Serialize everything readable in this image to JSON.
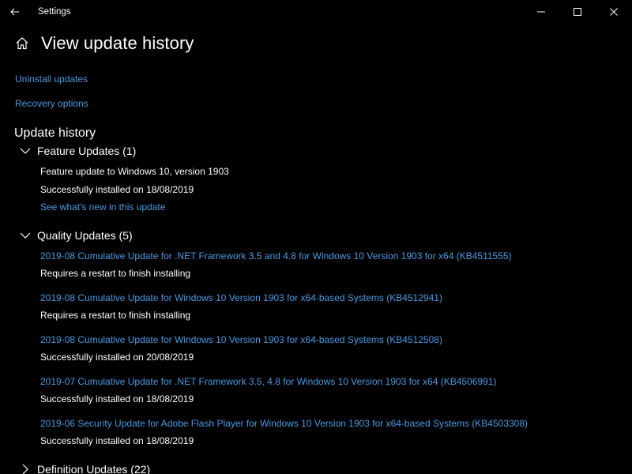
{
  "window": {
    "title": "Settings"
  },
  "header": {
    "page_title": "View update history"
  },
  "links": {
    "uninstall": "Uninstall updates",
    "recovery": "Recovery options"
  },
  "history": {
    "section_title": "Update history",
    "feature": {
      "label": "Feature Updates (1)",
      "items": [
        {
          "name": "Feature update to Windows 10, version 1903",
          "status": "Successfully installed on 18/08/2019",
          "link": "See what's new in this update"
        }
      ]
    },
    "quality": {
      "label": "Quality Updates (5)",
      "items": [
        {
          "name": "2019-08 Cumulative Update for .NET Framework 3.5 and 4.8 for Windows 10 Version 1903 for x64 (KB4511555)",
          "status": "Requires a restart to finish installing"
        },
        {
          "name": "2019-08 Cumulative Update for Windows 10 Version 1903 for x64-based Systems (KB4512941)",
          "status": "Requires a restart to finish installing"
        },
        {
          "name": "2019-08 Cumulative Update for Windows 10 Version 1903 for x64-based Systems (KB4512508)",
          "status": "Successfully installed on 20/08/2019"
        },
        {
          "name": "2019-07 Cumulative Update for .NET Framework 3.5, 4.8 for Windows 10 Version 1903 for x64 (KB4506991)",
          "status": "Successfully installed on 18/08/2019"
        },
        {
          "name": "2019-06 Security Update for Adobe Flash Player for Windows 10 Version 1903 for x64-based Systems (KB4503308)",
          "status": "Successfully installed on 18/08/2019"
        }
      ]
    },
    "definition": {
      "label": "Definition Updates (22)"
    }
  },
  "colors": {
    "background": "#000000",
    "text": "#ffffff",
    "link": "#4a9ae3"
  },
  "icons": {
    "back": "back-arrow-icon",
    "home": "home-icon",
    "minimize": "minimize-icon",
    "maximize": "maximize-icon",
    "close": "close-icon",
    "expanded": "chevron-down-icon",
    "collapsed": "chevron-right-icon"
  }
}
